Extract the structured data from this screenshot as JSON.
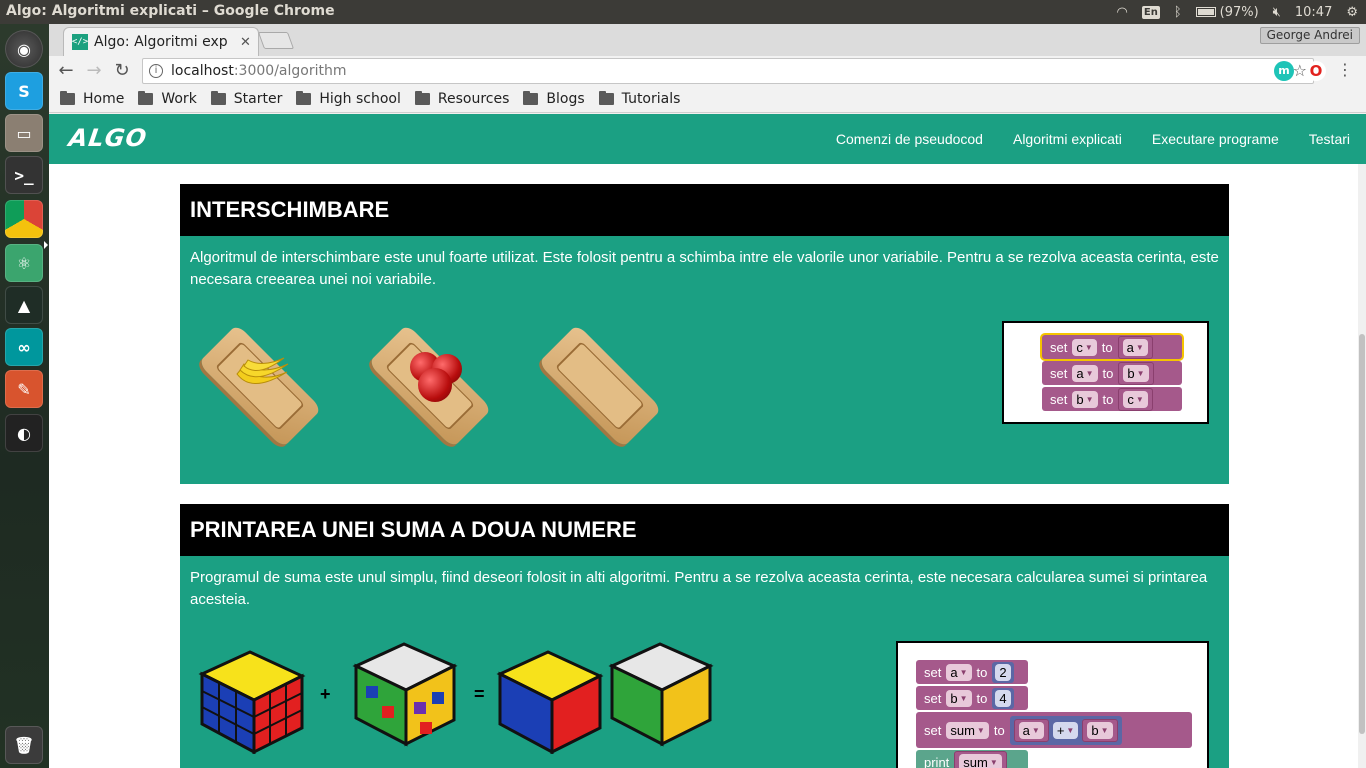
{
  "os": {
    "window_title": "Algo: Algoritmi explicati – Google Chrome",
    "tray": {
      "keyboard": "En",
      "battery": "(97%)",
      "time": "10:47"
    }
  },
  "browser": {
    "tab_title": "Algo: Algoritmi exp",
    "tab_close": "✕",
    "profile": "George Andrei",
    "url_host": "localhost",
    "url_path": ":3000/algorithm",
    "bookmarks": [
      "Home",
      "Work",
      "Starter",
      "High school",
      "Resources",
      "Blogs",
      "Tutorials"
    ]
  },
  "site": {
    "brand": "ALGO",
    "nav": [
      "Comenzi de pseudocod",
      "Algoritmi explicati",
      "Executare programe",
      "Testari"
    ]
  },
  "sections": [
    {
      "title": "INTERSCHIMBARE",
      "description": "Algoritmul de interschimbare este unul foarte utilizat. Este folosit pentru a schimba intre ele valorile unor variabile. Pentru a se rezolva aceasta cerinta, este necesara creearea unei noi variabile.",
      "blocks": [
        {
          "kw": "set",
          "var": "c",
          "to": "to",
          "val": "a"
        },
        {
          "kw": "set",
          "var": "a",
          "to": "to",
          "val": "b"
        },
        {
          "kw": "set",
          "var": "b",
          "to": "to",
          "val": "c"
        }
      ]
    },
    {
      "title": "PRINTAREA UNEI SUMA A DOUA NUMERE",
      "description": "Programul de suma este unul simplu, fiind deseori folosit in alti algoritmi. Pentru a se rezolva aceasta cerinta, este necesara calcularea sumei si printarea acesteia.",
      "signs": {
        "plus": "+",
        "equals": "="
      },
      "blocks": {
        "set_a": {
          "kw": "set",
          "var": "a",
          "to": "to",
          "num": "2"
        },
        "set_b": {
          "kw": "set",
          "var": "b",
          "to": "to",
          "num": "4"
        },
        "set_sum": {
          "kw": "set",
          "var": "sum",
          "to": "to",
          "left": "a",
          "op": "+",
          "right": "b"
        },
        "print": {
          "kw": "print",
          "var": "sum"
        }
      }
    }
  ]
}
